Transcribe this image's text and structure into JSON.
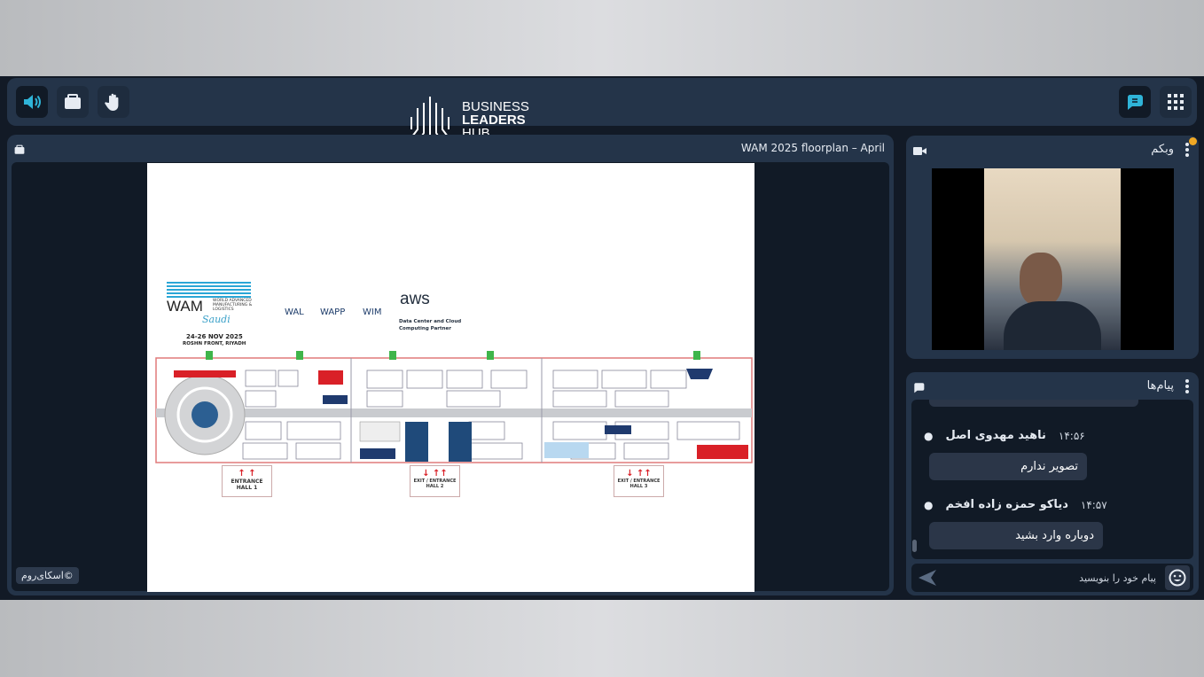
{
  "header": {
    "logo_line1": "BUSINESS",
    "logo_line2": "LEADERS",
    "logo_line3": "HUB"
  },
  "presentation": {
    "title": "WAM 2025 floorplan – April",
    "brand": "©اسکای‌روم"
  },
  "slide": {
    "event": "WAM",
    "event_sub": "WORLD ADVANCED MANUFACTURING & LOGISTICS",
    "event_region": "Saudi",
    "dates": "24-26 NOV 2025",
    "venue": "ROSHN FRONT, RIYADH",
    "partners": [
      "WAL",
      "WAPP",
      "WIM"
    ],
    "aws": "aws",
    "aws_caption1": "Data Center and Cloud",
    "aws_caption2": "Computing Partner",
    "entrances": [
      {
        "line1": "ENTRANCE",
        "line2": "HALL 1"
      },
      {
        "line1": "EXIT / ENTRANCE",
        "line2": "HALL 2"
      },
      {
        "line1": "EXIT / ENTRANCE",
        "line2": "HALL 3"
      }
    ]
  },
  "webcam": {
    "title": "وبکم"
  },
  "chat": {
    "title": "پیام‌ها",
    "messages": [
      {
        "author": "ناهید مهدوی اصل",
        "time": "۱۴:۵۶",
        "text": "تصویر ندارم"
      },
      {
        "author": "دیاکو حمزه زاده افخم",
        "time": "۱۴:۵۷",
        "text": "دوباره وارد بشید"
      }
    ],
    "placeholder": "پیام خود را بنویسید"
  },
  "colors": {
    "accent": "#2fb4d8",
    "panel": "#243449",
    "bg": "#121a26",
    "notify": "#f0a824"
  }
}
